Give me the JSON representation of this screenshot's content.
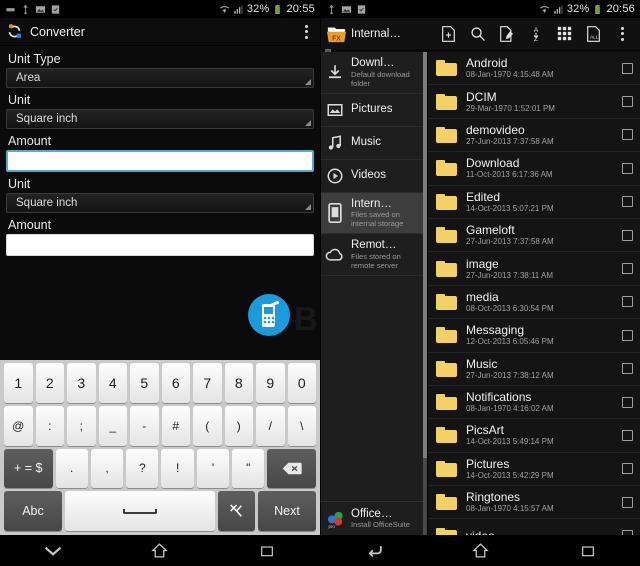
{
  "left": {
    "status_bar": {
      "time": "20:55",
      "battery": "32%",
      "icons": [
        "usb-icon",
        "screenshot-icon",
        "clipboard-icon",
        "wifi-icon",
        "signal-icon",
        "battery-icon"
      ]
    },
    "app": {
      "title": "Converter",
      "icon": "converter-icon",
      "overflow": "overflow-menu-icon"
    },
    "form": {
      "unit_type_label": "Unit Type",
      "unit_type_value": "Area",
      "unit_from_label": "Unit",
      "unit_from_value": "Square inch",
      "amount_from_label": "Amount",
      "amount_from_value": "",
      "unit_to_label": "Unit",
      "unit_to_value": "Square inch",
      "amount_to_label": "Amount",
      "amount_to_value": ""
    },
    "watermark": "BIGYAAN",
    "keyboard": {
      "row1": [
        "1",
        "2",
        "3",
        "4",
        "5",
        "6",
        "7",
        "8",
        "9",
        "0"
      ],
      "row2": [
        "@",
        ":",
        ";",
        "_",
        "-",
        "#",
        "(",
        ")",
        "/",
        "\\"
      ],
      "row3_left": "+ = $",
      "row3": [
        ".",
        ",",
        "?",
        "!",
        "'",
        "\""
      ],
      "row3_backspace": "backspace-icon",
      "row4_abc": "Abc",
      "row4_space": "space-key",
      "row4_settings": "settings-key-icon",
      "row4_next": "Next"
    },
    "navbar": {
      "back": "chevron-down-icon",
      "home": "home-icon",
      "recents": "recents-icon"
    }
  },
  "right": {
    "status_bar": {
      "time": "20:56",
      "battery": "32%"
    },
    "app": {
      "title": "Internal…",
      "logo": "fx-file-explorer-icon"
    },
    "toolbar_icons": [
      "new-file-icon",
      "search-icon",
      "edit-icon",
      "sort-az-icon",
      "grid-view-icon",
      "select-all-icon",
      "overflow-menu-icon"
    ],
    "sidebar": [
      {
        "title": "Downl…",
        "subtitle": "Default download folder",
        "icon": "download-icon",
        "active": false
      },
      {
        "title": "Pictures",
        "subtitle": "",
        "icon": "picture-icon",
        "active": false
      },
      {
        "title": "Music",
        "subtitle": "",
        "icon": "music-note-icon",
        "active": false
      },
      {
        "title": "Videos",
        "subtitle": "",
        "icon": "play-circle-icon",
        "active": false
      },
      {
        "title": "Intern…",
        "subtitle": "Files saved on internal storage",
        "icon": "phone-icon",
        "active": true
      },
      {
        "title": "Remot…",
        "subtitle": "Files stored on remote server",
        "icon": "cloud-icon",
        "active": false
      }
    ],
    "sidebar_bottom": {
      "title": "Office…",
      "subtitle": "Install OfficeSuite",
      "icon": "officesuite-pro-icon"
    },
    "files": [
      {
        "name": "Android",
        "date": "08-Jan-1970 4:15:48 AM"
      },
      {
        "name": "DCIM",
        "date": "29-Mar-1970 1:52:01 PM"
      },
      {
        "name": "demovideo",
        "date": "27-Jun-2013 7:37:58 AM"
      },
      {
        "name": "Download",
        "date": "11-Oct-2013 6:17:36 AM"
      },
      {
        "name": "Edited",
        "date": "14-Oct-2013 5:07:21 PM"
      },
      {
        "name": "Gameloft",
        "date": "27-Jun-2013 7:37:58 AM"
      },
      {
        "name": "image",
        "date": "27-Jun-2013 7:38:11 AM"
      },
      {
        "name": "media",
        "date": "08-Oct-2013 6:30:54 PM"
      },
      {
        "name": "Messaging",
        "date": "12-Oct-2013 6:05:46 PM"
      },
      {
        "name": "Music",
        "date": "27-Jun-2013 7:38:12 AM"
      },
      {
        "name": "Notifications",
        "date": "08-Jan-1970 4:16:02 AM"
      },
      {
        "name": "PicsArt",
        "date": "14-Oct-2013 5:49:14 PM"
      },
      {
        "name": "Pictures",
        "date": "14-Oct-2013 5:42:29 PM"
      },
      {
        "name": "Ringtones",
        "date": "08-Jan-1970 4:15:57 AM"
      },
      {
        "name": "video",
        "date": ""
      }
    ],
    "navbar": {
      "back": "back-icon",
      "home": "home-icon",
      "recents": "recents-icon"
    }
  },
  "colors": {
    "folder": "#f4d165",
    "accent_focus": "#57a8d4",
    "fx_logo": "#e7a31c",
    "logo_blue": "#1a9bdc"
  }
}
